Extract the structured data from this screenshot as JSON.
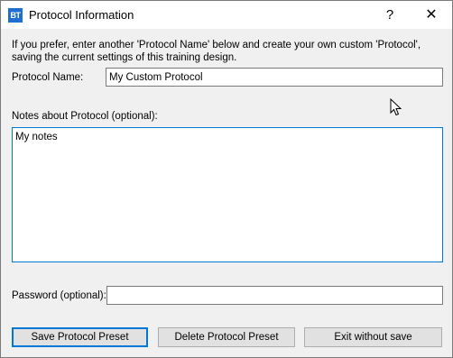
{
  "window": {
    "app_icon_text": "BT",
    "title": "Protocol Information",
    "help_label": "?",
    "close_label": "✕"
  },
  "intro_text": "If you prefer, enter another 'Protocol Name' below and create your own custom 'Protocol', saving the current settings of this training design.",
  "protocol_name": {
    "label": "Protocol Name:",
    "value": "My Custom Protocol"
  },
  "notes": {
    "label": "Notes about Protocol (optional):",
    "value": "My notes"
  },
  "password": {
    "label": "Password (optional):",
    "value": ""
  },
  "buttons": {
    "save": "Save Protocol Preset",
    "delete": "Delete Protocol Preset",
    "exit": "Exit without save"
  },
  "colors": {
    "app_icon": "#1e6fd1",
    "focus_border": "#0078d7",
    "dialog_bg": "#f0f0f0",
    "button_bg": "#e1e1e1"
  }
}
